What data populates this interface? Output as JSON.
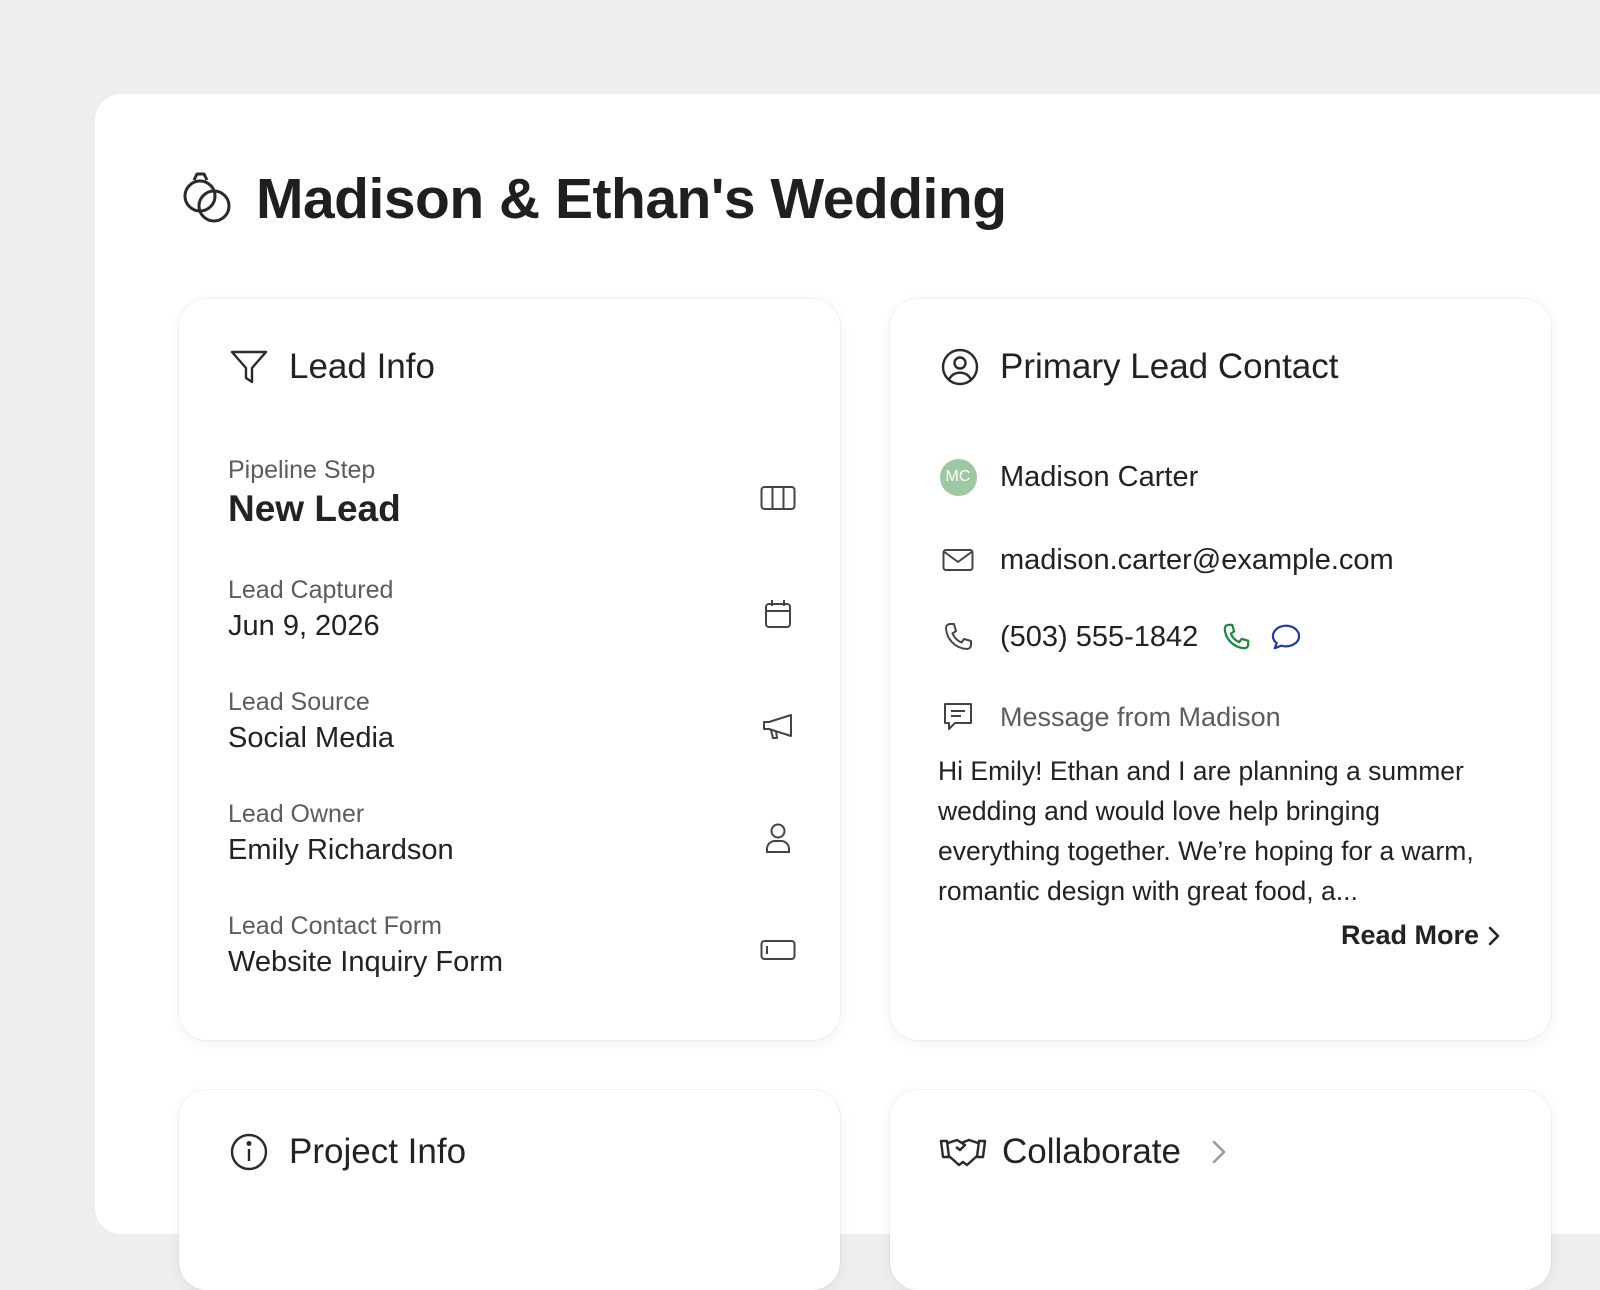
{
  "page": {
    "title": "Madison & Ethan's Wedding"
  },
  "lead_info": {
    "title": "Lead Info",
    "fields": [
      {
        "label": "Pipeline Step",
        "value": "New Lead",
        "icon": "columns-icon"
      },
      {
        "label": "Lead Captured",
        "value": "Jun 9, 2026",
        "icon": "calendar-icon"
      },
      {
        "label": "Lead Source",
        "value": "Social Media",
        "icon": "megaphone-icon"
      },
      {
        "label": "Lead Owner",
        "value": "Emily Richardson",
        "icon": "user-icon"
      },
      {
        "label": "Lead Contact Form",
        "value": "Website Inquiry Form",
        "icon": "form-field-icon"
      }
    ]
  },
  "primary_contact": {
    "title": "Primary Lead Contact",
    "avatar_initials": "MC",
    "avatar_color": "#9fc7a3",
    "name": "Madison Carter",
    "email": "madison.carter@example.com",
    "phone": "(503) 555-1842",
    "call_color": "#1f8a3d",
    "text_color": "#1e3fa8",
    "message_label": "Message from Madison",
    "message": "Hi Emily! Ethan and I are planning a summer wedding and would love help bringing everything together. We’re hoping for a warm, romantic design with great food, a...",
    "read_more": "Read More"
  },
  "project_info": {
    "title": "Project Info"
  },
  "collaborate": {
    "title": "Collaborate"
  }
}
